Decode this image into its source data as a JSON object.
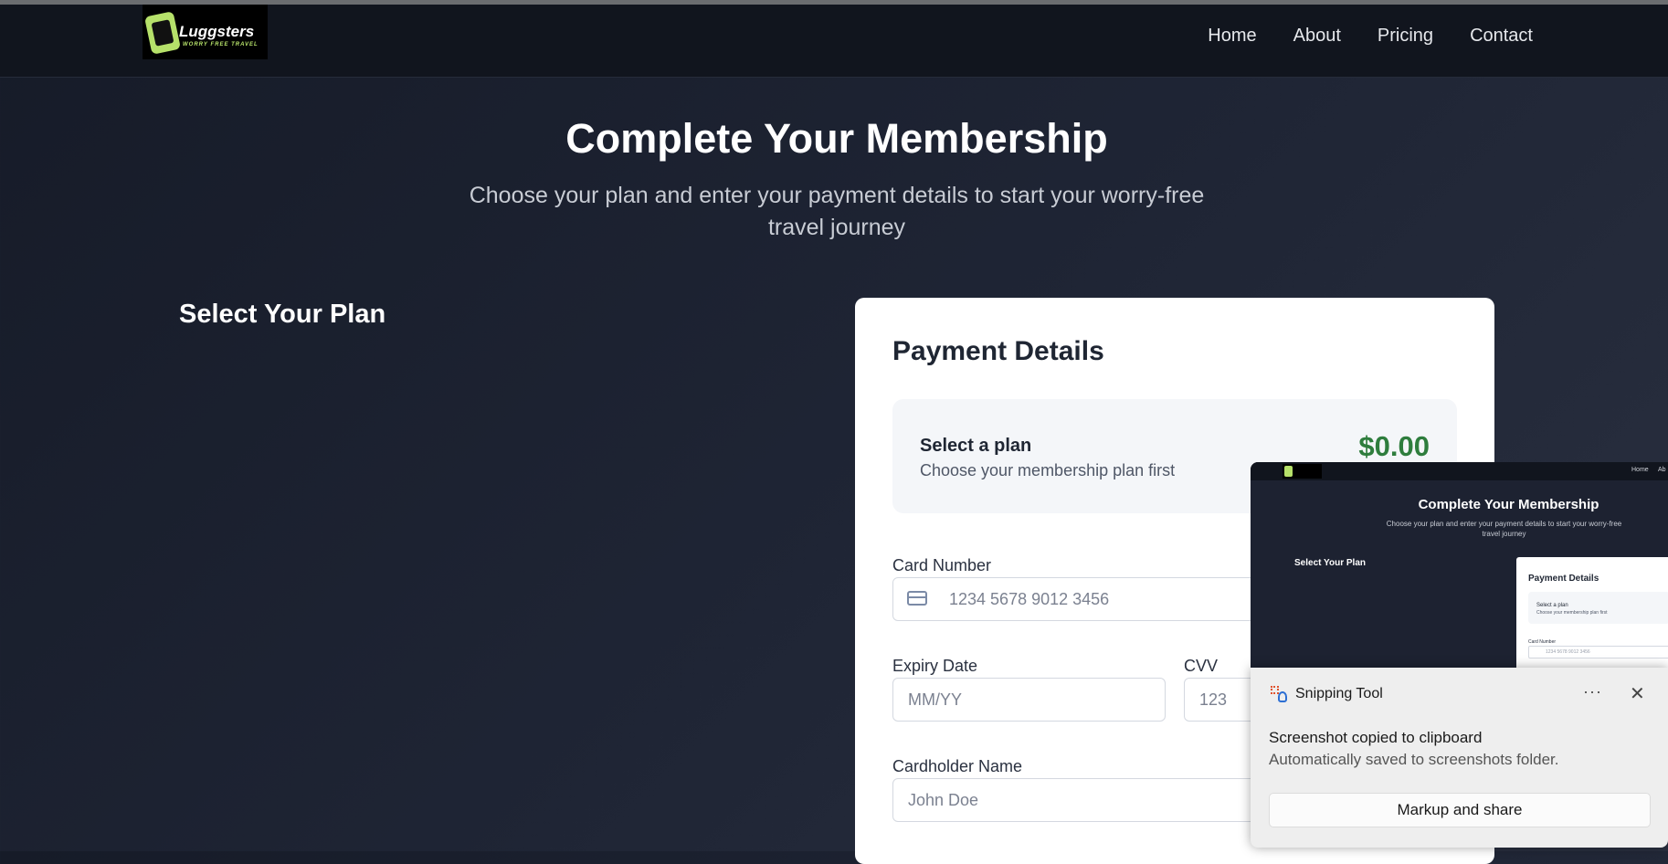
{
  "nav": {
    "logo_text": "Luggsters",
    "logo_tagline": "WORRY FREE TRAVEL",
    "links": [
      "Home",
      "About",
      "Pricing",
      "Contact"
    ]
  },
  "hero": {
    "title": "Complete Your Membership",
    "subtitle": "Choose your plan and enter your payment details to start your worry-free travel journey"
  },
  "plans": {
    "title": "Select Your Plan"
  },
  "payment": {
    "title": "Payment Details",
    "summary": {
      "title": "Select a plan",
      "subtitle": "Choose your membership plan first",
      "price": "$0.00"
    },
    "card_number": {
      "label": "Card Number",
      "placeholder": "1234 5678 9012 3456"
    },
    "expiry": {
      "label": "Expiry Date",
      "placeholder": "MM/YY"
    },
    "cvv": {
      "label": "CVV",
      "placeholder": "123"
    },
    "cardholder": {
      "label": "Cardholder Name",
      "placeholder": "John Doe"
    }
  },
  "snipping_tool": {
    "preview": {
      "nav_home": "Home",
      "nav_about": "Ab",
      "title": "Complete Your Membership",
      "subtitle": "Choose your plan and enter your payment details to start your worry-free travel journey",
      "plan_title": "Select Your Plan",
      "card_title": "Payment Details",
      "summary_title": "Select a plan",
      "summary_sub": "Choose your membership plan first",
      "card_label": "Card Number",
      "card_placeholder": "1234 5678 9012 3456"
    },
    "app_name": "Snipping Tool",
    "more_label": "···",
    "close_label": "✕",
    "message": "Screenshot copied to clipboard",
    "sub_message": "Automatically saved to screenshots folder.",
    "action_label": "Markup and share"
  },
  "colors": {
    "price": "#2e7d3d",
    "accent_logo": "#b6e16a"
  }
}
